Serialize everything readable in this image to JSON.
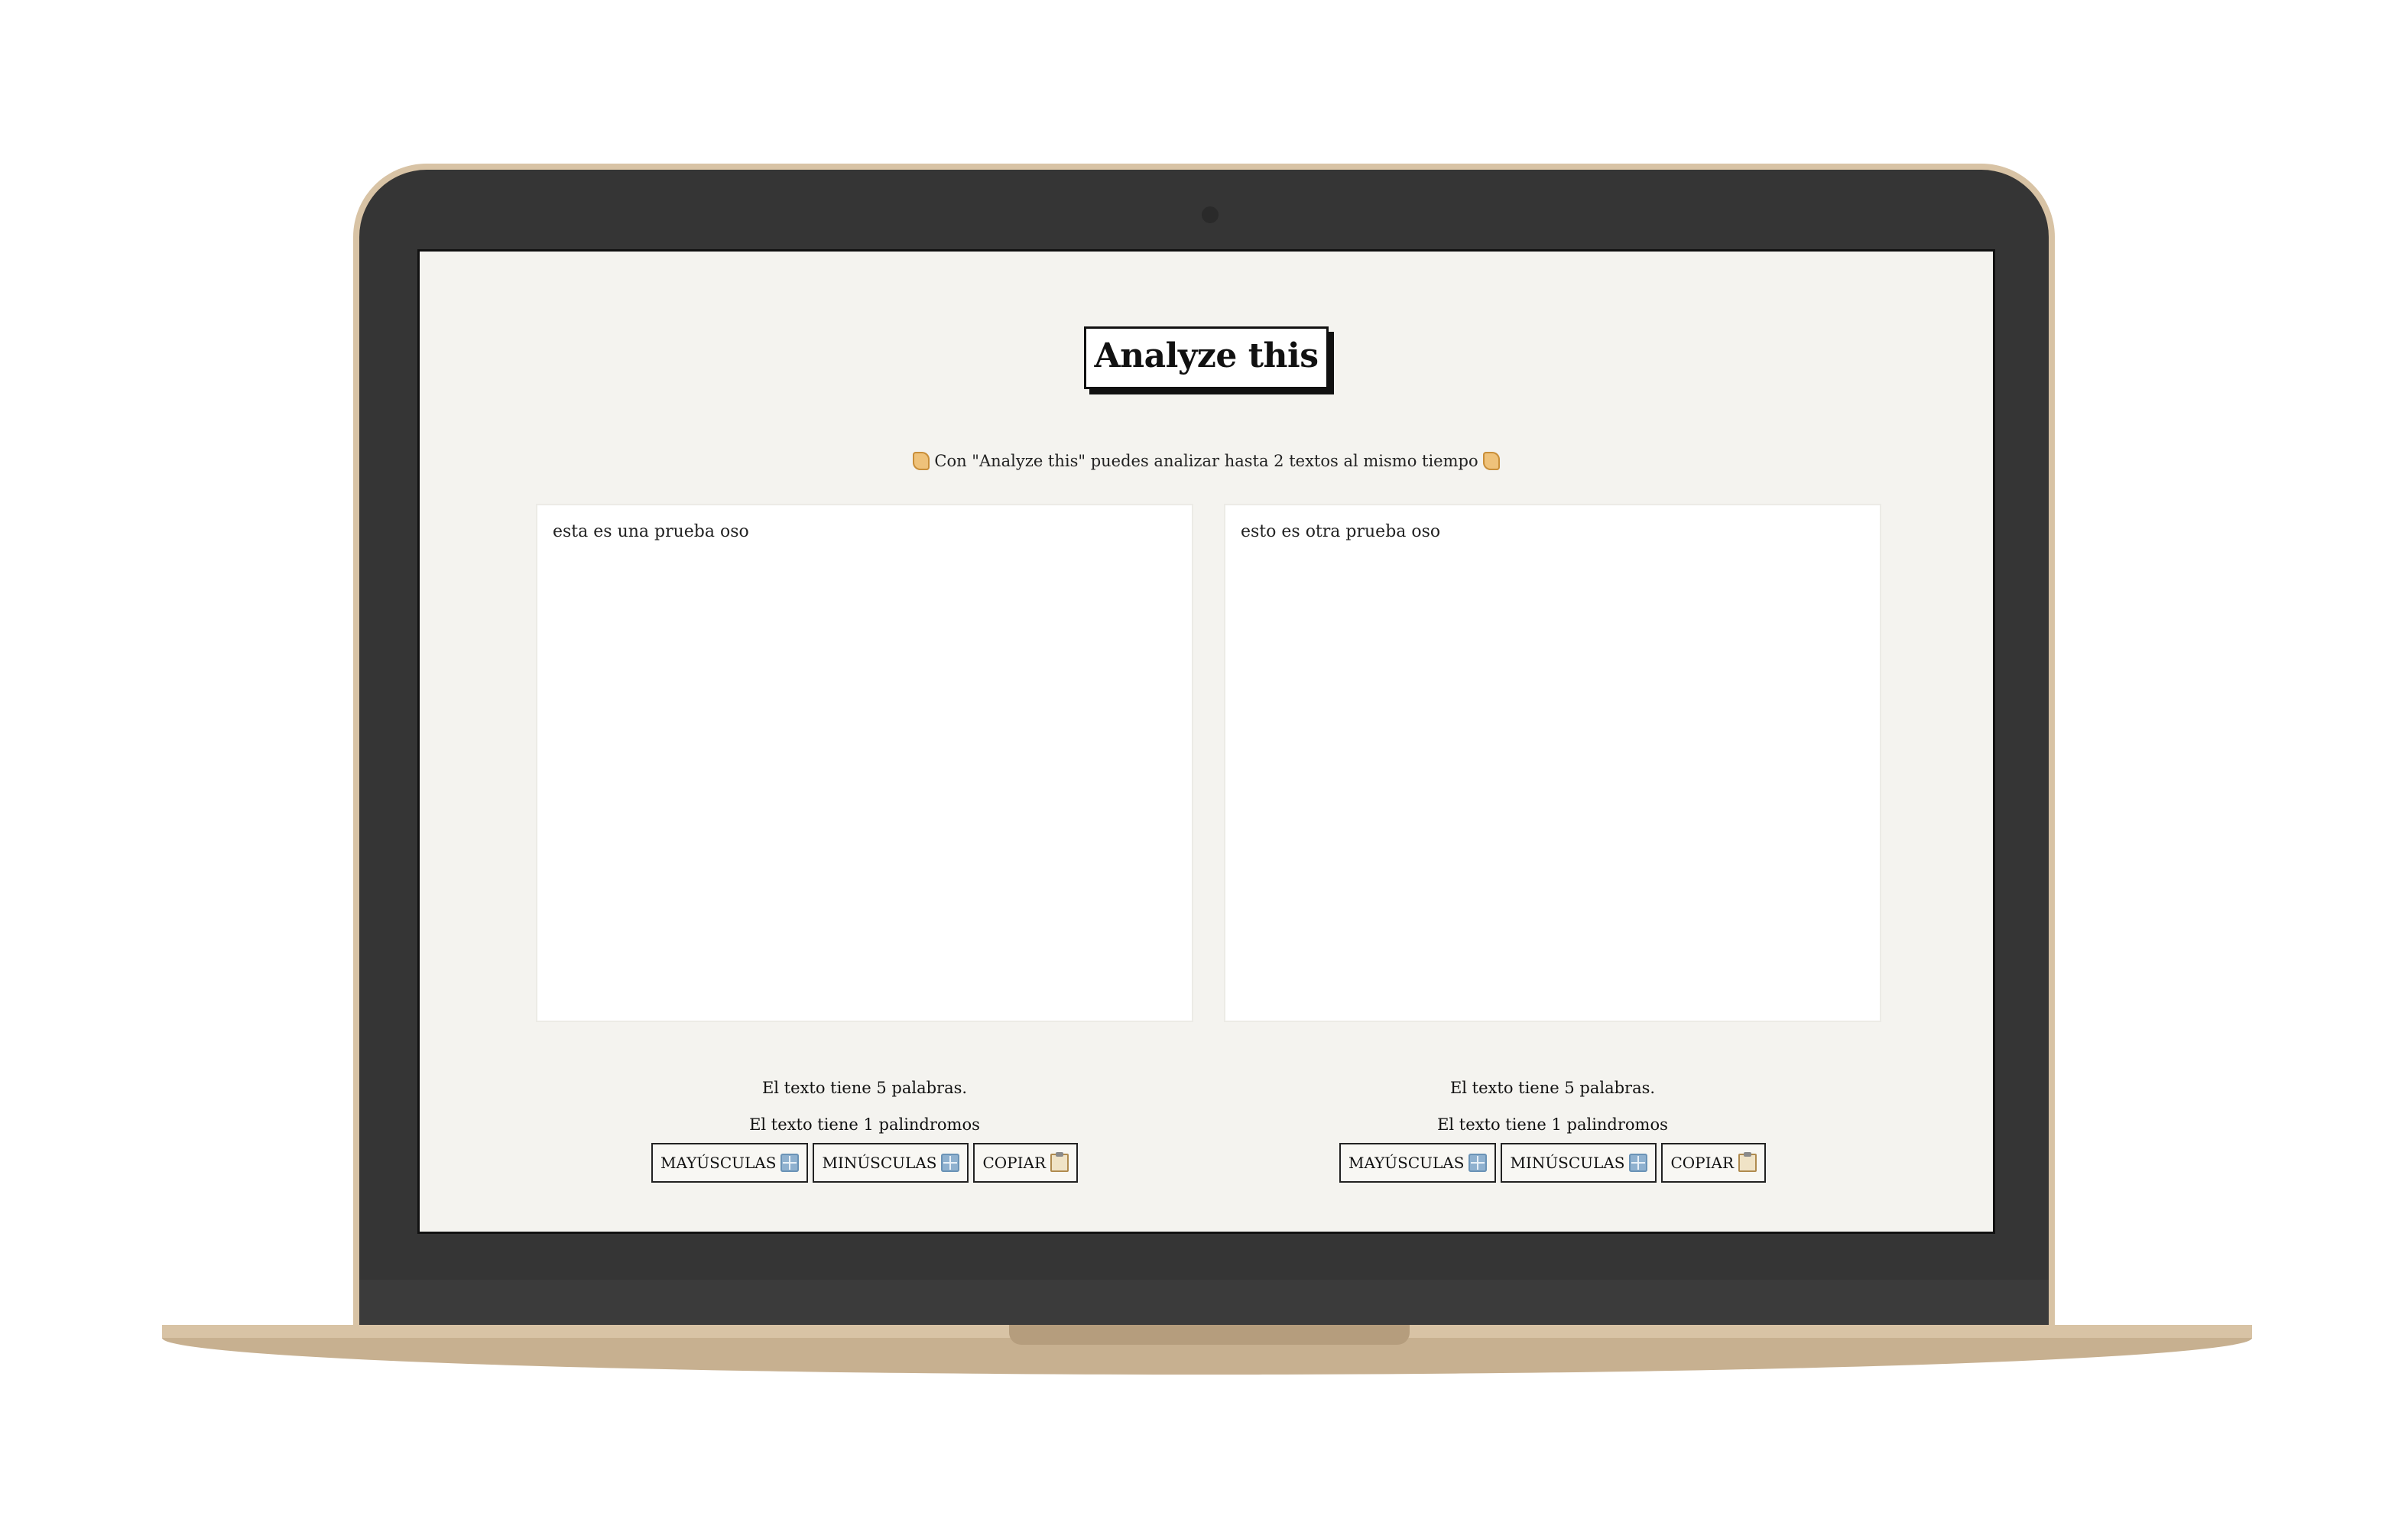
{
  "app": {
    "title": "Analyze this",
    "subtitle": "Con \"Analyze this\" puedes analizar hasta 2 textos al mismo tiempo"
  },
  "panels": [
    {
      "text": "esta es una prueba oso",
      "word_count_text": "El texto tiene 5 palabras.",
      "palindrome_text": "El texto tiene 1 palindromos",
      "buttons": {
        "upper": "MAYÚSCULAS",
        "lower": "MINÚSCULAS",
        "copy": "COPIAR"
      }
    },
    {
      "text": "esto es otra prueba oso",
      "word_count_text": "El texto tiene 5 palabras.",
      "palindrome_text": "El texto tiene 1 palindromos",
      "buttons": {
        "upper": "MAYÚSCULAS",
        "lower": "MINÚSCULAS",
        "copy": "COPIAR"
      }
    }
  ],
  "icons": {
    "subtitle_left": "scroll-icon",
    "subtitle_right": "scroll-icon",
    "upper": "input-latin-uppercase-icon",
    "lower": "input-latin-lowercase-icon",
    "copy": "clipboard-icon"
  },
  "colors": {
    "screen_background": "#f4f3ef",
    "device_frame": "#d8c3a5",
    "bezel": "#353535"
  }
}
